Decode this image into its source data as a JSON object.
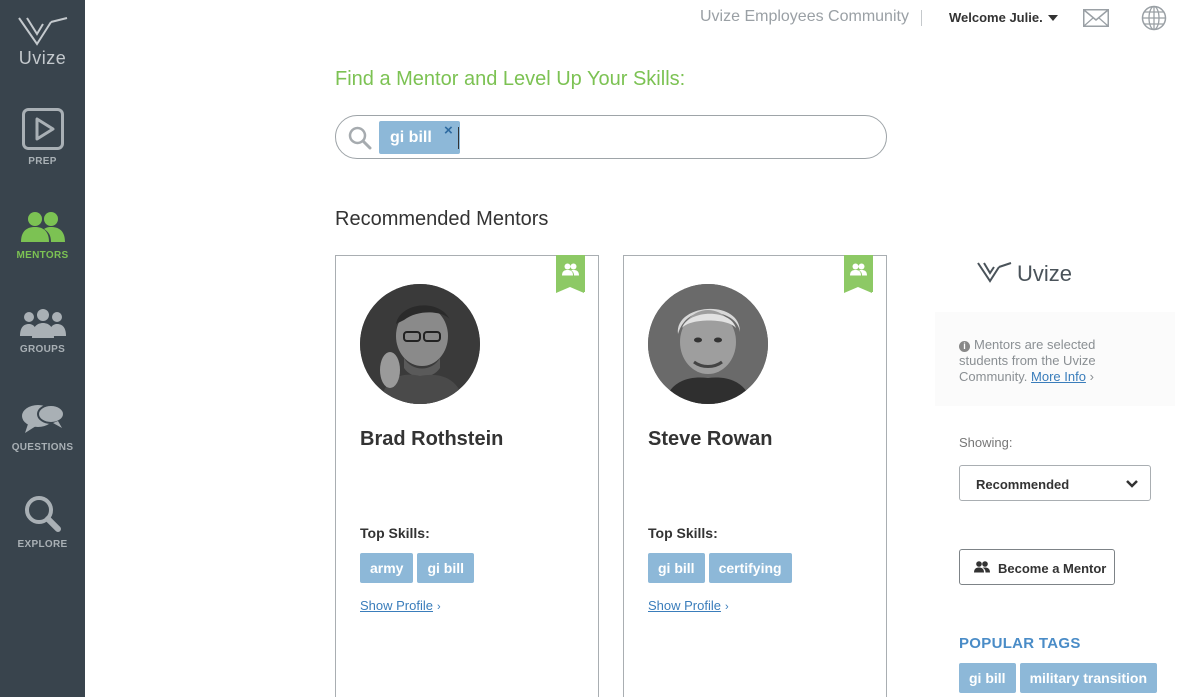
{
  "sidebar": {
    "logo_text": "Uvize",
    "items": [
      {
        "label": "PREP",
        "icon": "play-icon"
      },
      {
        "label": "MENTORS",
        "icon": "mentors-icon",
        "active": true
      },
      {
        "label": "GROUPS",
        "icon": "groups-icon"
      },
      {
        "label": "QUESTIONS",
        "icon": "questions-icon"
      },
      {
        "label": "EXPLORE",
        "icon": "magnifier-icon"
      }
    ]
  },
  "header": {
    "community": "Uvize Employees Community",
    "welcome": "Welcome Julie."
  },
  "main": {
    "find_title": "Find a Mentor and Level Up Your Skills:",
    "search_tag": "gi bill",
    "search_tag_remove": "×",
    "recommended_title": "Recommended Mentors"
  },
  "mentors": [
    {
      "name": "Brad Rothstein",
      "top_skills_label": "Top Skills:",
      "skills": [
        "army",
        "gi bill"
      ],
      "show_profile": "Show Profile"
    },
    {
      "name": "Steve Rowan",
      "top_skills_label": "Top Skills:",
      "skills": [
        "gi bill",
        "certifying"
      ],
      "show_profile": "Show Profile"
    }
  ],
  "right_panel": {
    "logo_text": "Uvize",
    "info_text": "Mentors are selected students from the Uvize Community.",
    "more_info": "More Info",
    "showing_label": "Showing:",
    "showing_value": "Recommended",
    "become_mentor": "Become a Mentor",
    "popular_tags_title": "POPULAR TAGS",
    "popular_tags": [
      "gi bill",
      "military transition"
    ]
  },
  "colors": {
    "sidebar_bg": "#39444d",
    "accent_green": "#7cc253",
    "tag_blue": "#8db8d8",
    "link_blue": "#3a7dbb"
  }
}
